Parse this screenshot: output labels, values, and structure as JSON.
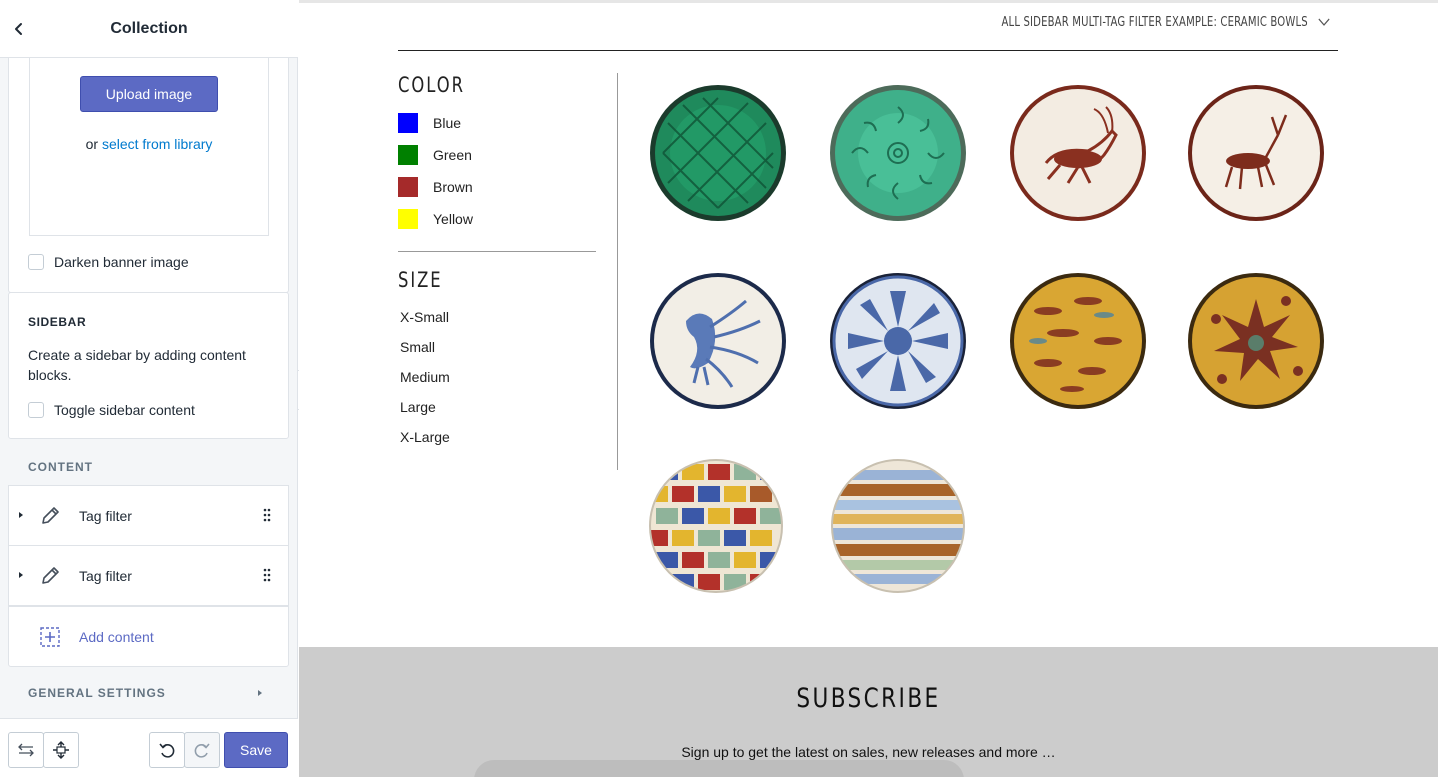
{
  "editor": {
    "title": "Collection",
    "upload_button": "Upload image",
    "or_text": "or",
    "library_link": "select from library",
    "darken_label": "Darken banner image",
    "sidebar_heading": "SIDEBAR",
    "sidebar_text": "Create a sidebar by adding content blocks.",
    "toggle_label": "Toggle sidebar content",
    "content_heading": "CONTENT",
    "blocks": [
      {
        "label": "Tag filter"
      },
      {
        "label": "Tag filter"
      }
    ],
    "add_content": "Add content",
    "general_settings": "GENERAL SETTINGS",
    "save_label": "Save"
  },
  "preview": {
    "collection_select": "ALL SIDEBAR MULTI-TAG FILTER EXAMPLE: CERAMIC BOWLS",
    "color_heading": "COLOR",
    "colors": [
      {
        "label": "Blue",
        "hex": "#0000ff"
      },
      {
        "label": "Green",
        "hex": "#008000"
      },
      {
        "label": "Brown",
        "hex": "#a52a2a"
      },
      {
        "label": "Yellow",
        "hex": "#ffff00"
      }
    ],
    "size_heading": "SIZE",
    "sizes": [
      "X-Small",
      "Small",
      "Medium",
      "Large",
      "X-Large"
    ],
    "products": [
      {
        "style": "green-lattice"
      },
      {
        "style": "green-swirl"
      },
      {
        "style": "cream-antelope"
      },
      {
        "style": "cream-deer"
      },
      {
        "style": "blue-bird"
      },
      {
        "style": "blue-flower"
      },
      {
        "style": "yellow-fish"
      },
      {
        "style": "yellow-star"
      },
      {
        "style": "multicolor-check"
      },
      {
        "style": "stripes"
      }
    ],
    "subscribe_title": "SUBSCRIBE",
    "subscribe_text": "Sign up to get the latest on sales, new releases and more …"
  }
}
